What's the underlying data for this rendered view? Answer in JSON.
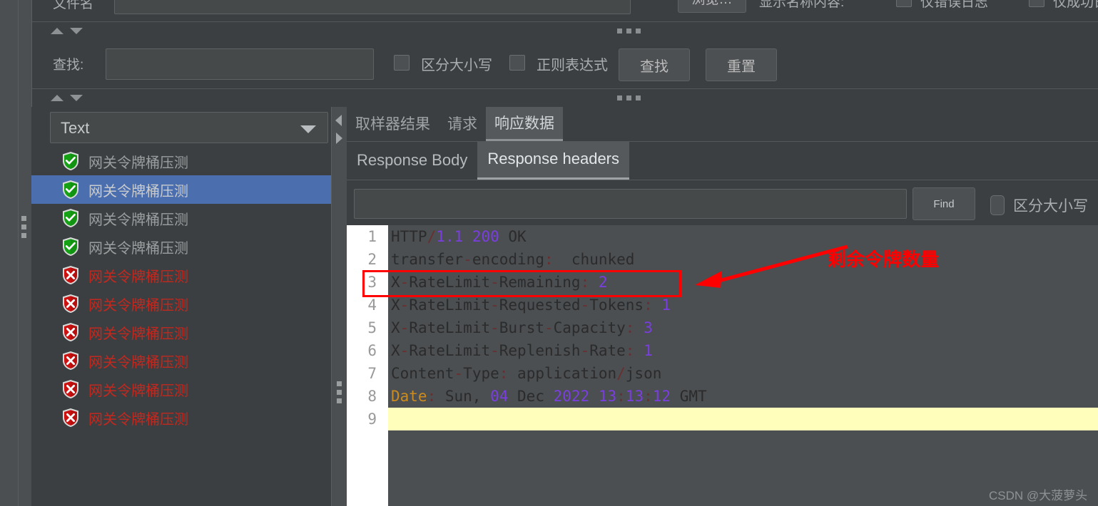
{
  "top_bar": {
    "filename_label": "文件名",
    "filename_value": "",
    "browse_button": "浏览…",
    "display_name_label": "显示名称内容:",
    "checkbox1_label": "仅错误日志",
    "checkbox2_label": "仅成功日志"
  },
  "search_bar": {
    "label": "查找:",
    "value": "",
    "case_sensitive_label": "区分大小写",
    "regex_label": "正则表达式",
    "find_button": "查找",
    "reset_button": "重置"
  },
  "left_panel": {
    "combo_value": "Text",
    "items": [
      {
        "label": "网关令牌桶压测",
        "status": "ok",
        "selected": false
      },
      {
        "label": "网关令牌桶压测",
        "status": "ok",
        "selected": true
      },
      {
        "label": "网关令牌桶压测",
        "status": "ok",
        "selected": false
      },
      {
        "label": "网关令牌桶压测",
        "status": "ok",
        "selected": false
      },
      {
        "label": "网关令牌桶压测",
        "status": "error",
        "selected": false
      },
      {
        "label": "网关令牌桶压测",
        "status": "error",
        "selected": false
      },
      {
        "label": "网关令牌桶压测",
        "status": "error",
        "selected": false
      },
      {
        "label": "网关令牌桶压测",
        "status": "error",
        "selected": false
      },
      {
        "label": "网关令牌桶压测",
        "status": "error",
        "selected": false
      },
      {
        "label": "网关令牌桶压测",
        "status": "error",
        "selected": false
      }
    ]
  },
  "right_panel": {
    "tabs": [
      {
        "label": "取样器结果",
        "active": false
      },
      {
        "label": "请求",
        "active": false
      },
      {
        "label": "响应数据",
        "active": true
      }
    ],
    "subtabs": [
      {
        "label": "Response Body",
        "active": false
      },
      {
        "label": "Response headers",
        "active": true
      }
    ],
    "find_bar": {
      "value": "",
      "find_button": "Find",
      "case_sensitive_label": "区分大小写"
    },
    "code": {
      "line_numbers": [
        "1",
        "2",
        "3",
        "4",
        "5",
        "6",
        "7",
        "8",
        "9"
      ],
      "lines": [
        {
          "n": "1",
          "parts": [
            {
              "t": "HTTP",
              "c": "key"
            },
            {
              "t": "/",
              "c": "punct"
            },
            {
              "t": "1.1",
              "c": "num"
            },
            {
              "t": " ",
              "c": "key"
            },
            {
              "t": "200",
              "c": "num"
            },
            {
              "t": " OK",
              "c": "key"
            }
          ]
        },
        {
          "n": "2",
          "parts": [
            {
              "t": "transfer",
              "c": "key"
            },
            {
              "t": "-",
              "c": "punct"
            },
            {
              "t": "encoding",
              "c": "key"
            },
            {
              "t": ":",
              "c": "punct"
            },
            {
              "t": "  chunked",
              "c": "key"
            }
          ]
        },
        {
          "n": "3",
          "parts": [
            {
              "t": "X",
              "c": "key"
            },
            {
              "t": "-",
              "c": "punct"
            },
            {
              "t": "RateLimit",
              "c": "key"
            },
            {
              "t": "-",
              "c": "punct"
            },
            {
              "t": "Remaining",
              "c": "key"
            },
            {
              "t": ":",
              "c": "punct"
            },
            {
              "t": " ",
              "c": "key"
            },
            {
              "t": "2",
              "c": "num"
            }
          ]
        },
        {
          "n": "4",
          "parts": [
            {
              "t": "X",
              "c": "key"
            },
            {
              "t": "-",
              "c": "punct"
            },
            {
              "t": "RateLimit",
              "c": "key"
            },
            {
              "t": "-",
              "c": "punct"
            },
            {
              "t": "Requested",
              "c": "key"
            },
            {
              "t": "-",
              "c": "punct"
            },
            {
              "t": "Tokens",
              "c": "key"
            },
            {
              "t": ":",
              "c": "punct"
            },
            {
              "t": " ",
              "c": "key"
            },
            {
              "t": "1",
              "c": "num"
            }
          ]
        },
        {
          "n": "5",
          "parts": [
            {
              "t": "X",
              "c": "key"
            },
            {
              "t": "-",
              "c": "punct"
            },
            {
              "t": "RateLimit",
              "c": "key"
            },
            {
              "t": "-",
              "c": "punct"
            },
            {
              "t": "Burst",
              "c": "key"
            },
            {
              "t": "-",
              "c": "punct"
            },
            {
              "t": "Capacity",
              "c": "key"
            },
            {
              "t": ":",
              "c": "punct"
            },
            {
              "t": " ",
              "c": "key"
            },
            {
              "t": "3",
              "c": "num"
            }
          ]
        },
        {
          "n": "6",
          "parts": [
            {
              "t": "X",
              "c": "key"
            },
            {
              "t": "-",
              "c": "punct"
            },
            {
              "t": "RateLimit",
              "c": "key"
            },
            {
              "t": "-",
              "c": "punct"
            },
            {
              "t": "Replenish",
              "c": "key"
            },
            {
              "t": "-",
              "c": "punct"
            },
            {
              "t": "Rate",
              "c": "key"
            },
            {
              "t": ":",
              "c": "punct"
            },
            {
              "t": " ",
              "c": "key"
            },
            {
              "t": "1",
              "c": "num"
            }
          ]
        },
        {
          "n": "7",
          "parts": [
            {
              "t": "Content",
              "c": "key"
            },
            {
              "t": "-",
              "c": "punct"
            },
            {
              "t": "Type",
              "c": "key"
            },
            {
              "t": ":",
              "c": "punct"
            },
            {
              "t": " application",
              "c": "key"
            },
            {
              "t": "/",
              "c": "punct"
            },
            {
              "t": "json",
              "c": "key"
            }
          ]
        },
        {
          "n": "8",
          "parts": [
            {
              "t": "Date",
              "c": "date"
            },
            {
              "t": ":",
              "c": "punct"
            },
            {
              "t": " Sun, ",
              "c": "key"
            },
            {
              "t": "04",
              "c": "num"
            },
            {
              "t": " Dec ",
              "c": "key"
            },
            {
              "t": "2022",
              "c": "num"
            },
            {
              "t": " ",
              "c": "key"
            },
            {
              "t": "13",
              "c": "num"
            },
            {
              "t": ":",
              "c": "punct"
            },
            {
              "t": "13",
              "c": "num"
            },
            {
              "t": ":",
              "c": "punct"
            },
            {
              "t": "12",
              "c": "num"
            },
            {
              "t": " GMT",
              "c": "key"
            }
          ]
        },
        {
          "n": "9",
          "parts": [],
          "highlight": true
        }
      ]
    }
  },
  "annotation": {
    "text": "剩余令牌数量",
    "color": "#ff0000"
  },
  "watermark": "CSDN @大菠萝头",
  "colors": {
    "background": "#4b4f52",
    "panel": "#3c3f41",
    "selection": "#4b6eaf",
    "ok": "#1a9e1a",
    "error": "#c3281f",
    "accent_number": "#7a3ee0",
    "highlight_line": "#ffffbb"
  }
}
